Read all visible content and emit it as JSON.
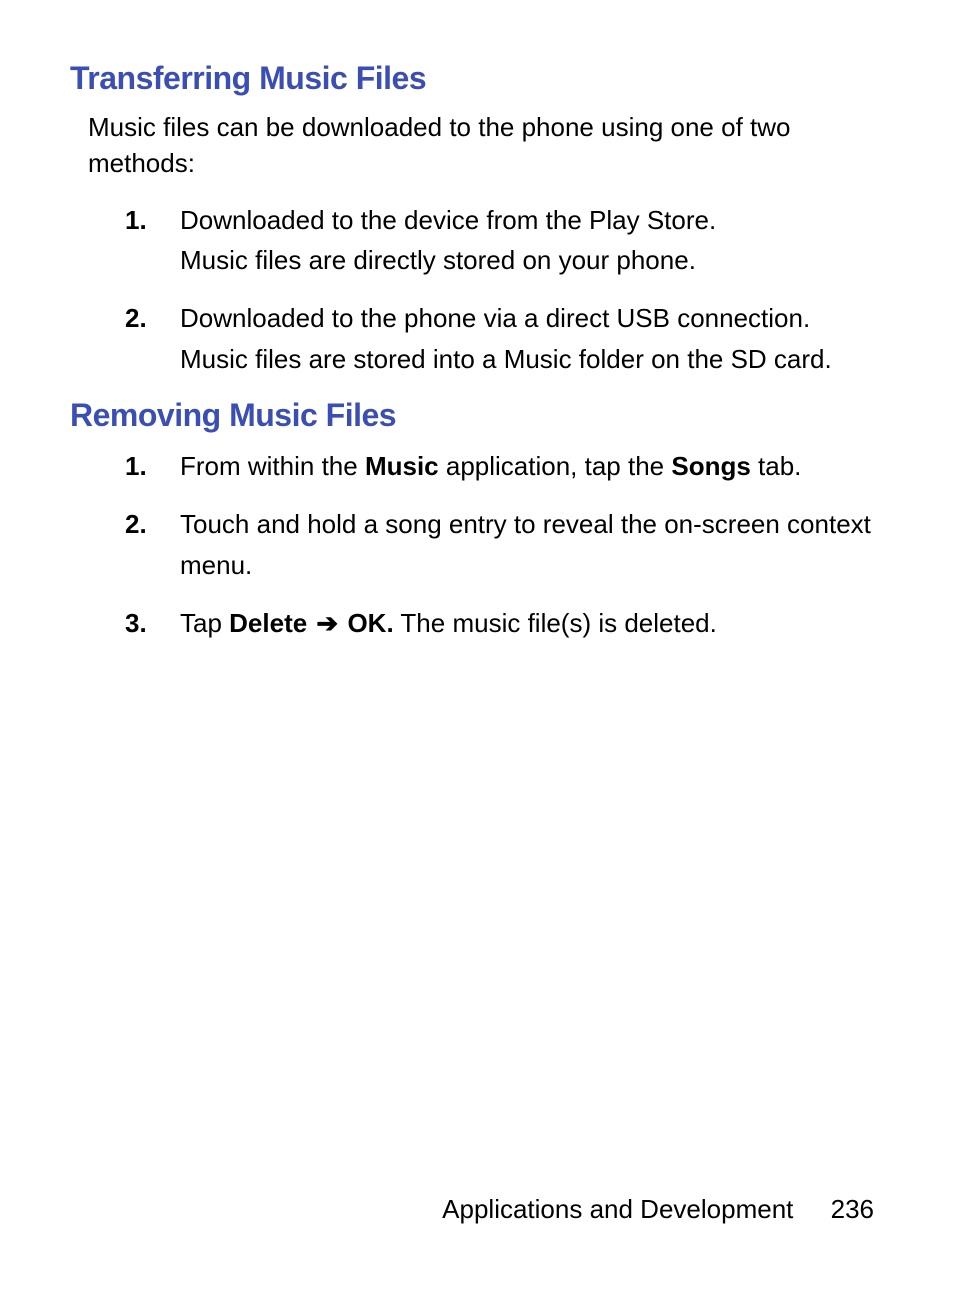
{
  "section1": {
    "heading": "Transferring Music Files",
    "intro": "Music files can be downloaded to the phone using one of two methods:",
    "items": [
      {
        "line1": "Downloaded to the device from the Play Store.",
        "line2": "Music files are directly stored on your phone."
      },
      {
        "line1": "Downloaded to the phone via a direct USB connection.",
        "line2": "Music files are stored into a Music folder on the SD card."
      }
    ]
  },
  "section2": {
    "heading": "Removing Music Files",
    "items": [
      {
        "pre": "From within the ",
        "bold1": "Music",
        "mid": " application, tap the ",
        "bold2": "Songs",
        "post": " tab."
      },
      {
        "text": "Touch and hold a song entry to reveal the on-screen context menu."
      },
      {
        "pre": "Tap ",
        "bold1": "Delete",
        "arrow": " ➔ ",
        "bold2": "OK.",
        "post": " The music file(s) is deleted."
      }
    ]
  },
  "footer": {
    "title": "Applications and Development",
    "page": "236"
  }
}
